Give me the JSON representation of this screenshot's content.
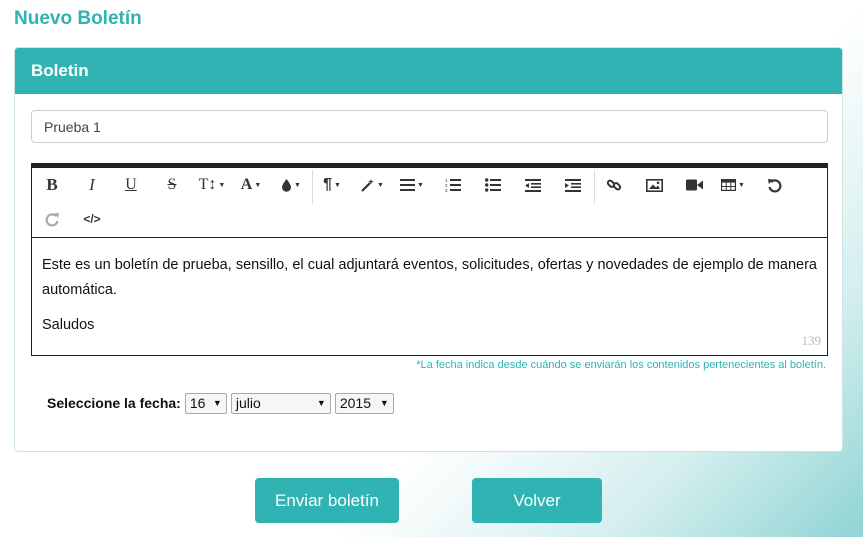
{
  "page": {
    "title": "Nuevo Boletín"
  },
  "panel": {
    "heading": "Boletin"
  },
  "form": {
    "title_value": "Prueba 1",
    "editor": {
      "paragraph1": "Este es un boletín de prueba, sensillo, el cual adjuntará eventos, solicitudes, ofertas y novedades de ejemplo de manera automática.",
      "paragraph2": "Saludos",
      "char_count": "139",
      "toolbar": [
        "bold-icon",
        "italic-icon",
        "underline-icon",
        "strikethrough-icon",
        "font-size-icon",
        "font-color-icon",
        "highlight-color-icon",
        "paragraph-style-icon",
        "magic-style-icon",
        "align-icon",
        "ordered-list-icon",
        "unordered-list-icon",
        "outdent-icon",
        "indent-icon",
        "link-icon",
        "image-icon",
        "video-icon",
        "table-icon",
        "undo-icon",
        "redo-icon",
        "code-view-icon"
      ]
    },
    "note": "*La fecha indica desde cuándo se enviarán los contenidos pertenecientes al boletín.",
    "date": {
      "label": "Seleccione la fecha:",
      "day": "16",
      "month": "julio",
      "year": "2015"
    }
  },
  "actions": {
    "submit": "Enviar boletín",
    "back": "Volver"
  },
  "colors": {
    "accent": "#2fb3b3"
  }
}
